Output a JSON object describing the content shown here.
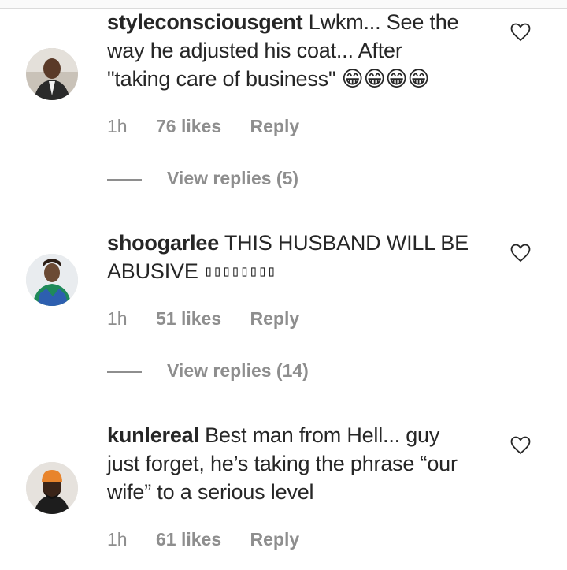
{
  "comments": [
    {
      "username": "styleconsciousgent",
      "text_line1": " Lwkm... See the",
      "text_line2": "way he adjusted his coat... After",
      "text_line3": "\"taking care of business\" ",
      "emoji": "😁😁😁😁",
      "time": "1h",
      "likes": "76 likes",
      "reply": "Reply",
      "view_replies": "View replies (5)"
    },
    {
      "username": "shoogarlee",
      "text_line1": " THIS HUSBAND WILL BE",
      "text_line2": "ABUSIVE ",
      "unrendered": "▯▯▯▯▯▯▯▯",
      "time": "1h",
      "likes": "51 likes",
      "reply": "Reply",
      "view_replies": "View replies (14)"
    },
    {
      "username": "kunlereal",
      "text_line1": " Best man from Hell... guy",
      "text_line2": "just forget, he’s taking the phrase “our",
      "text_line3": "wife” to a serious level",
      "time": "1h",
      "likes": "61 likes",
      "reply": "Reply"
    }
  ],
  "icons": {
    "like": "heart-outline-icon"
  },
  "colors": {
    "text": "#262626",
    "secondary": "#8e8e8e"
  }
}
